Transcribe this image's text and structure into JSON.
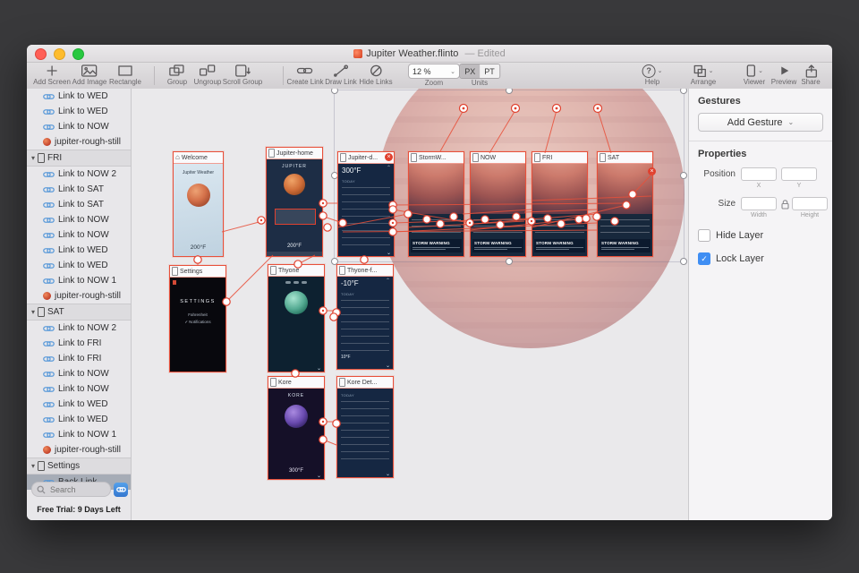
{
  "window": {
    "title": "Jupiter Weather.flinto",
    "edited_suffix": "— Edited"
  },
  "toolbar": {
    "add_screen": "Add Screen",
    "add_image": "Add Image",
    "rectangle": "Rectangle",
    "group": "Group",
    "ungroup": "Ungroup",
    "scroll_group": "Scroll Group",
    "create_link": "Create Link",
    "draw_link": "Draw Link",
    "hide_links": "Hide Links",
    "zoom_label": "Zoom",
    "zoom_value": "12 %",
    "units_label": "Units",
    "units_px": "PX",
    "units_pt": "PT",
    "help": "Help",
    "arrange": "Arrange",
    "viewer": "Viewer",
    "preview": "Preview",
    "share": "Share"
  },
  "sidebar": {
    "items": [
      {
        "type": "link",
        "label": "Link to WED"
      },
      {
        "type": "link",
        "label": "Link to WED"
      },
      {
        "type": "link",
        "label": "Link to NOW"
      },
      {
        "type": "image",
        "label": "jupiter-rough-still"
      },
      {
        "type": "group",
        "label": "FRI"
      },
      {
        "type": "link",
        "label": "Link to NOW 2"
      },
      {
        "type": "link",
        "label": "Link to SAT"
      },
      {
        "type": "link",
        "label": "Link to SAT"
      },
      {
        "type": "link",
        "label": "Link to NOW"
      },
      {
        "type": "link",
        "label": "Link to NOW"
      },
      {
        "type": "link",
        "label": "Link to WED"
      },
      {
        "type": "link",
        "label": "Link to WED"
      },
      {
        "type": "link",
        "label": "Link to NOW 1"
      },
      {
        "type": "image",
        "label": "jupiter-rough-still"
      },
      {
        "type": "group",
        "label": "SAT"
      },
      {
        "type": "link",
        "label": "Link to NOW 2"
      },
      {
        "type": "link",
        "label": "Link to FRI"
      },
      {
        "type": "link",
        "label": "Link to FRI"
      },
      {
        "type": "link",
        "label": "Link to NOW"
      },
      {
        "type": "link",
        "label": "Link to NOW"
      },
      {
        "type": "link",
        "label": "Link to WED"
      },
      {
        "type": "link",
        "label": "Link to WED"
      },
      {
        "type": "link",
        "label": "Link to NOW 1"
      },
      {
        "type": "image",
        "label": "jupiter-rough-still"
      },
      {
        "type": "group",
        "label": "Settings"
      },
      {
        "type": "backlink",
        "label": "Back Link"
      }
    ],
    "search_placeholder": "Search",
    "trial_text": "Free Trial: 9 Days Left"
  },
  "canvas": {
    "screens": [
      {
        "title": "Welcome",
        "app_name": "Jupiter Weather",
        "temp": "200°F"
      },
      {
        "title": "Jupiter-home",
        "name": "JUPITER",
        "temp": "200°F"
      },
      {
        "title": "Jupiter-d...",
        "temp": "300°F",
        "section": "TODAY"
      },
      {
        "title": "StormW...",
        "banner": "STORM WARNING"
      },
      {
        "title": "NOW",
        "banner": "STORM WARNING"
      },
      {
        "title": "FRI",
        "banner": "STORM WARNING"
      },
      {
        "title": "SAT",
        "banner": "STORM WARNING"
      },
      {
        "title": "Settings",
        "heading": "SETTINGS",
        "option_temp": "Fahrenheit",
        "option_notif": "Notifications"
      },
      {
        "title": "Thyone"
      },
      {
        "title": "Thyone-f...",
        "temp": "-10°F",
        "section": "TODAY",
        "temp_low": "10°F"
      },
      {
        "title": "Kore",
        "name": "KORE",
        "temp": "300°F"
      },
      {
        "title": "Kore Det...",
        "section": "TODAY"
      }
    ]
  },
  "inspector": {
    "gestures_title": "Gestures",
    "add_gesture_label": "Add Gesture",
    "properties_title": "Properties",
    "position_label": "Position",
    "x_label": "X",
    "y_label": "Y",
    "size_label": "Size",
    "width_label": "Width",
    "height_label": "Height",
    "hide_layer_label": "Hide Layer",
    "lock_layer_label": "Lock Layer"
  },
  "colors": {
    "selection_red": "#e0412f",
    "link_blue": "#4f94d8",
    "checkbox_blue": "#3f8ef3"
  }
}
